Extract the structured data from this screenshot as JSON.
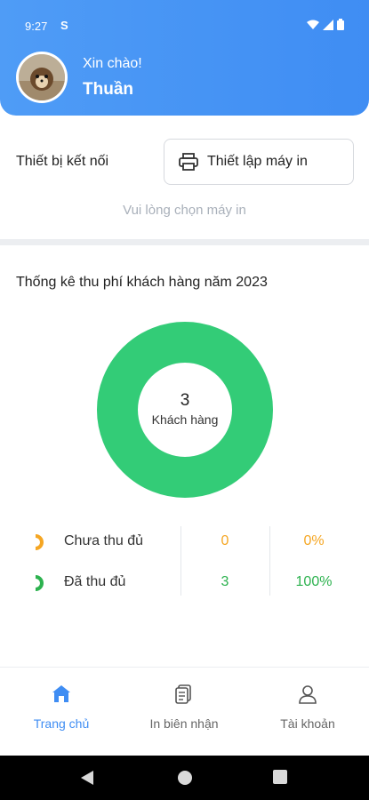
{
  "status_bar": {
    "time": "9:27",
    "indicator": "S"
  },
  "header": {
    "greeting": "Xin chào!",
    "user_name": "Thuần"
  },
  "device": {
    "label": "Thiết bị kết nối",
    "printer_button": "Thiết lập máy in",
    "hint": "Vui lòng chọn máy in"
  },
  "stats": {
    "title": "Thống kê thu phí khách hàng năm 2023",
    "donut_value": "3",
    "donut_label": "Khách hàng",
    "rows": [
      {
        "label": "Chưa thu đủ",
        "count": "0",
        "percent": "0%",
        "color": "#f5a623"
      },
      {
        "label": "Đã thu đủ",
        "count": "3",
        "percent": "100%",
        "color": "#2db24f"
      }
    ],
    "ring_color": "#33cc77"
  },
  "chart_data": {
    "type": "pie",
    "categories": [
      "Chưa thu đủ",
      "Đã thu đủ"
    ],
    "values": [
      0,
      3
    ],
    "title": "Thống kê thu phí khách hàng năm 2023"
  },
  "bottom_nav": {
    "items": [
      {
        "label": "Trang chủ",
        "icon": "home-icon"
      },
      {
        "label": "In biên nhận",
        "icon": "receipt-icon"
      },
      {
        "label": "Tài khoản",
        "icon": "account-icon"
      }
    ],
    "active_color": "#3f8df3"
  },
  "colors": {
    "header": "#4f9cf6"
  }
}
